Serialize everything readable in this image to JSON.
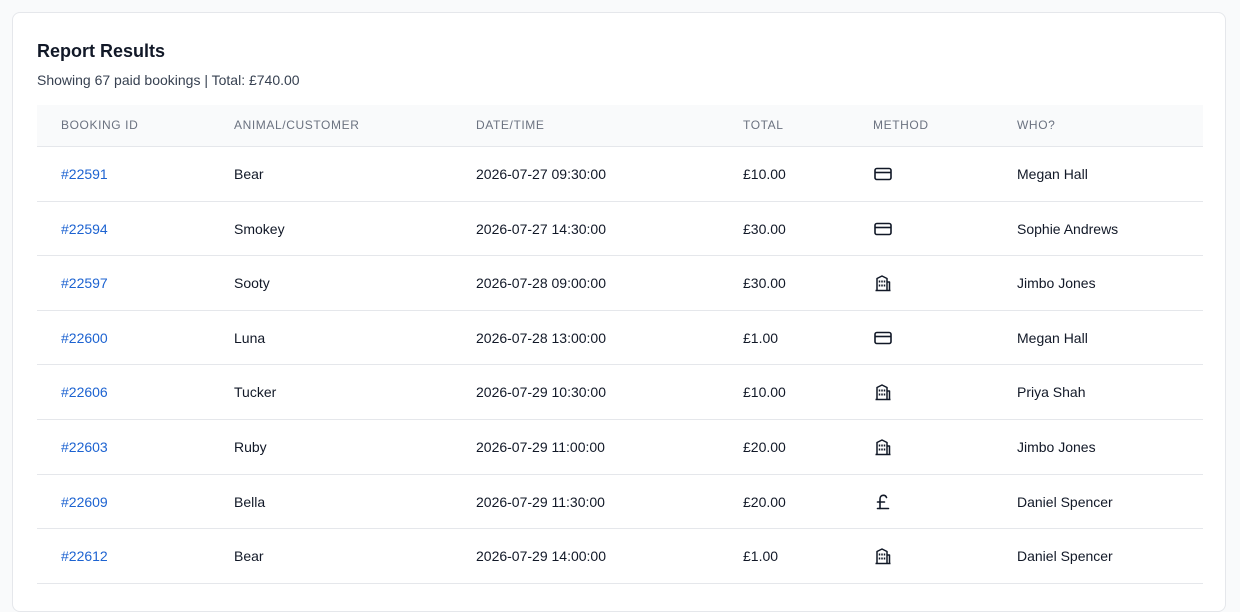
{
  "report": {
    "title": "Report Results",
    "summary": "Showing 67 paid bookings | Total: £740.00"
  },
  "table": {
    "headers": {
      "booking_id": "BOOKING ID",
      "animal": "ANIMAL/CUSTOMER",
      "datetime": "DATE/TIME",
      "total": "TOTAL",
      "method": "METHOD",
      "who": "WHO?"
    },
    "rows": [
      {
        "id": "#22591",
        "animal": "Bear",
        "datetime": "2026-07-27 09:30:00",
        "total": "£10.00",
        "method": "card-icon",
        "who": "Megan Hall"
      },
      {
        "id": "#22594",
        "animal": "Smokey",
        "datetime": "2026-07-27 14:30:00",
        "total": "£30.00",
        "method": "card-icon",
        "who": "Sophie Andrews"
      },
      {
        "id": "#22597",
        "animal": "Sooty",
        "datetime": "2026-07-28 09:00:00",
        "total": "£30.00",
        "method": "building-icon",
        "who": "Jimbo Jones"
      },
      {
        "id": "#22600",
        "animal": "Luna",
        "datetime": "2026-07-28 13:00:00",
        "total": "£1.00",
        "method": "card-icon",
        "who": "Megan Hall"
      },
      {
        "id": "#22606",
        "animal": "Tucker",
        "datetime": "2026-07-29 10:30:00",
        "total": "£10.00",
        "method": "building-icon",
        "who": "Priya Shah"
      },
      {
        "id": "#22603",
        "animal": "Ruby",
        "datetime": "2026-07-29 11:00:00",
        "total": "£20.00",
        "method": "building-icon",
        "who": "Jimbo Jones"
      },
      {
        "id": "#22609",
        "animal": "Bella",
        "datetime": "2026-07-29 11:30:00",
        "total": "£20.00",
        "method": "pound-icon",
        "who": "Daniel Spencer"
      },
      {
        "id": "#22612",
        "animal": "Bear",
        "datetime": "2026-07-29 14:00:00",
        "total": "£1.00",
        "method": "building-icon",
        "who": "Daniel Spencer"
      }
    ]
  },
  "colors": {
    "link": "#1d63d1",
    "header_bg": "#f9fafb",
    "border": "#e5e7eb"
  }
}
